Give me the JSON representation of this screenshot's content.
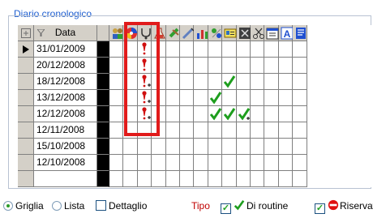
{
  "panel": {
    "title": "Diario cronologico"
  },
  "header": {
    "date_label": "Data"
  },
  "icons": [
    "people-icon",
    "color-wheel-icon",
    "stethoscope-icon",
    "flask-icon",
    "bandage-icon",
    "syringe-icon",
    "bar-chart-icon",
    "hands-icon",
    "id-card-icon",
    "x-ray-icon",
    "scissors-icon",
    "calendar-icon",
    "letter-a-icon",
    "notes-icon"
  ],
  "rows": [
    {
      "date": "31/01/2009",
      "selected": true
    },
    {
      "date": "20/12/2008",
      "selected": false
    },
    {
      "date": "18/12/2008",
      "selected": false
    },
    {
      "date": "13/12/2008",
      "selected": false
    },
    {
      "date": "12/12/2008",
      "selected": false
    },
    {
      "date": "12/11/2008",
      "selected": false
    },
    {
      "date": "15/10/2008",
      "selected": false
    },
    {
      "date": "12/10/2008",
      "selected": false
    },
    {
      "date": "",
      "selected": false
    }
  ],
  "marks": [
    {
      "row": 0,
      "col": 2,
      "type": "exclaim"
    },
    {
      "row": 1,
      "col": 2,
      "type": "exclaim"
    },
    {
      "row": 2,
      "col": 2,
      "type": "exclaim-plus"
    },
    {
      "row": 3,
      "col": 2,
      "type": "exclaim-plus"
    },
    {
      "row": 4,
      "col": 2,
      "type": "exclaim-plus"
    },
    {
      "row": 2,
      "col": 8,
      "type": "check"
    },
    {
      "row": 3,
      "col": 7,
      "type": "check"
    },
    {
      "row": 4,
      "col": 7,
      "type": "check"
    },
    {
      "row": 4,
      "col": 8,
      "type": "check"
    },
    {
      "row": 4,
      "col": 9,
      "type": "check-plus"
    }
  ],
  "bottom": {
    "griglia": "Griglia",
    "lista": "Lista",
    "dettaglio": "Dettaglio",
    "tipo": "Tipo",
    "routine": "Di routine",
    "riservato": "Riservato",
    "view": "griglia"
  }
}
